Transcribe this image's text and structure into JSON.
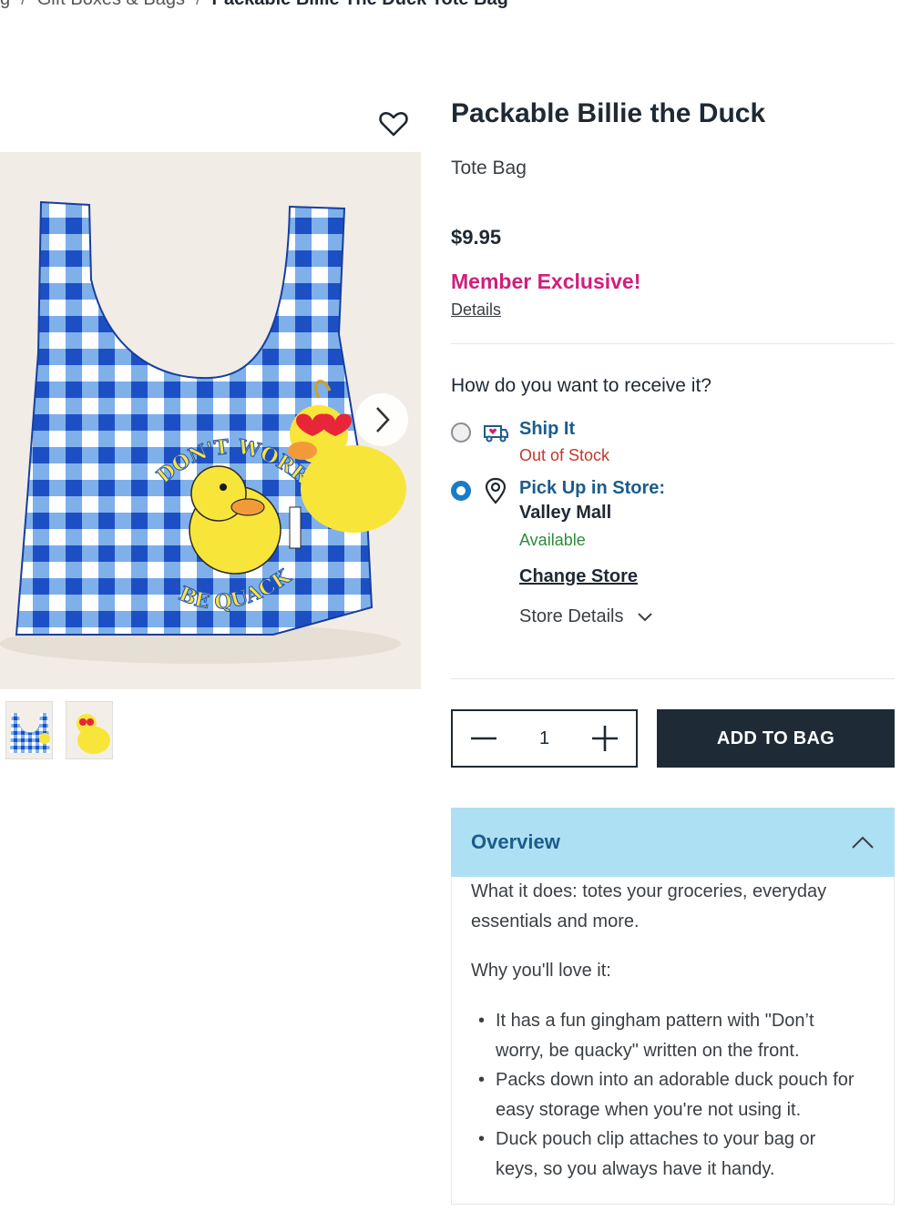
{
  "breadcrumb": {
    "prev2": "g",
    "prev1": "Gift Boxes & Bags",
    "current": "Packable Billie The Duck Tote Bag"
  },
  "product": {
    "title": "Packable Billie the Duck",
    "subtitle": "Tote Bag",
    "price": "$9.95",
    "member_badge": "Member Exclusive!",
    "details_link": "Details",
    "image_icons": [
      "wishlist-heart-icon",
      "next-image-chevron-icon"
    ]
  },
  "delivery": {
    "question": "How do you want to receive it?",
    "ship": {
      "label": "Ship It",
      "status": "Out of Stock",
      "selected": false,
      "icon": "truck-heart-icon"
    },
    "pickup": {
      "label": "Pick Up in Store:",
      "store": "Valley Mall",
      "status": "Available",
      "selected": true,
      "icon": "map-pin-icon"
    },
    "change_store": "Change Store",
    "store_details": "Store Details"
  },
  "cart": {
    "quantity": "1",
    "add_label": "ADD TO BAG"
  },
  "overview": {
    "title": "Overview",
    "what_it_does": "What it does: totes your groceries, everyday essentials and more.",
    "why_label": "Why you'll love it:",
    "bullets": [
      "It has a fun gingham pattern with \"Don’t worry, be quacky\" written on the front.",
      "Packs down into an adorable duck pouch for easy storage when you're not using it.",
      "Duck pouch clip attaches to your bag or keys, so you always have it handy."
    ]
  },
  "image_text": {
    "top_arc": "DON'T WORRY",
    "bottom_arc": "BE QUACKY"
  },
  "colors": {
    "brand_pink": "#d01f7c",
    "link_blue": "#1b5c8c",
    "radio_blue": "#1a7cc4",
    "overview_bg": "#aee0f3",
    "button_dark": "#1e2a35",
    "gingham_blue": "#1d4fc4",
    "duck_yellow": "#f8e53a"
  }
}
